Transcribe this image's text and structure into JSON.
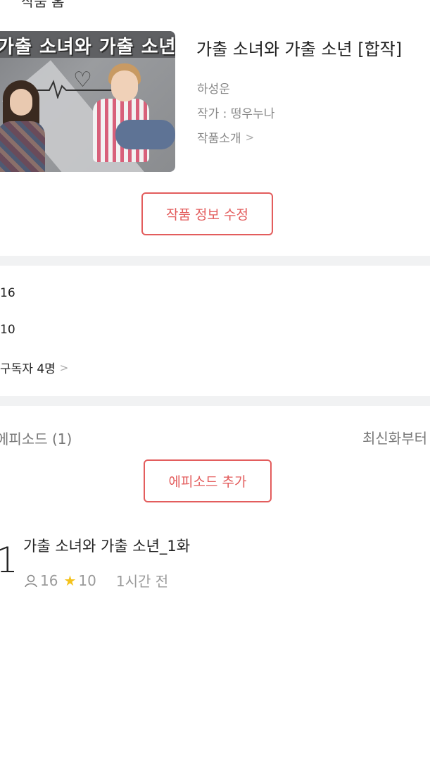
{
  "top_fragment": "작품 홈",
  "series": {
    "title": "가출 소녀와 가출 소년 [합작]",
    "author_name": "하성운",
    "writer": "작가 : 떵우누나",
    "intro_link": "작품소개",
    "cover_text": "가출 소녀와 가출 소년"
  },
  "edit_button": "작품 정보 수정",
  "stats": {
    "views": "16",
    "stars": "10",
    "subscribers": "구독자 4명"
  },
  "episodes": {
    "count_label": "에피소드 (1)",
    "sort_label": "최신화부터",
    "add_button": "에피소드 추가",
    "items": [
      {
        "number": "1",
        "title": "가출 소녀와 가출 소년_1화",
        "views": "16",
        "stars": "10",
        "time": "1시간 전"
      }
    ]
  },
  "colors": {
    "accent": "#e35d5d",
    "star": "#f4c21b",
    "separator": "#f1f2f3"
  }
}
